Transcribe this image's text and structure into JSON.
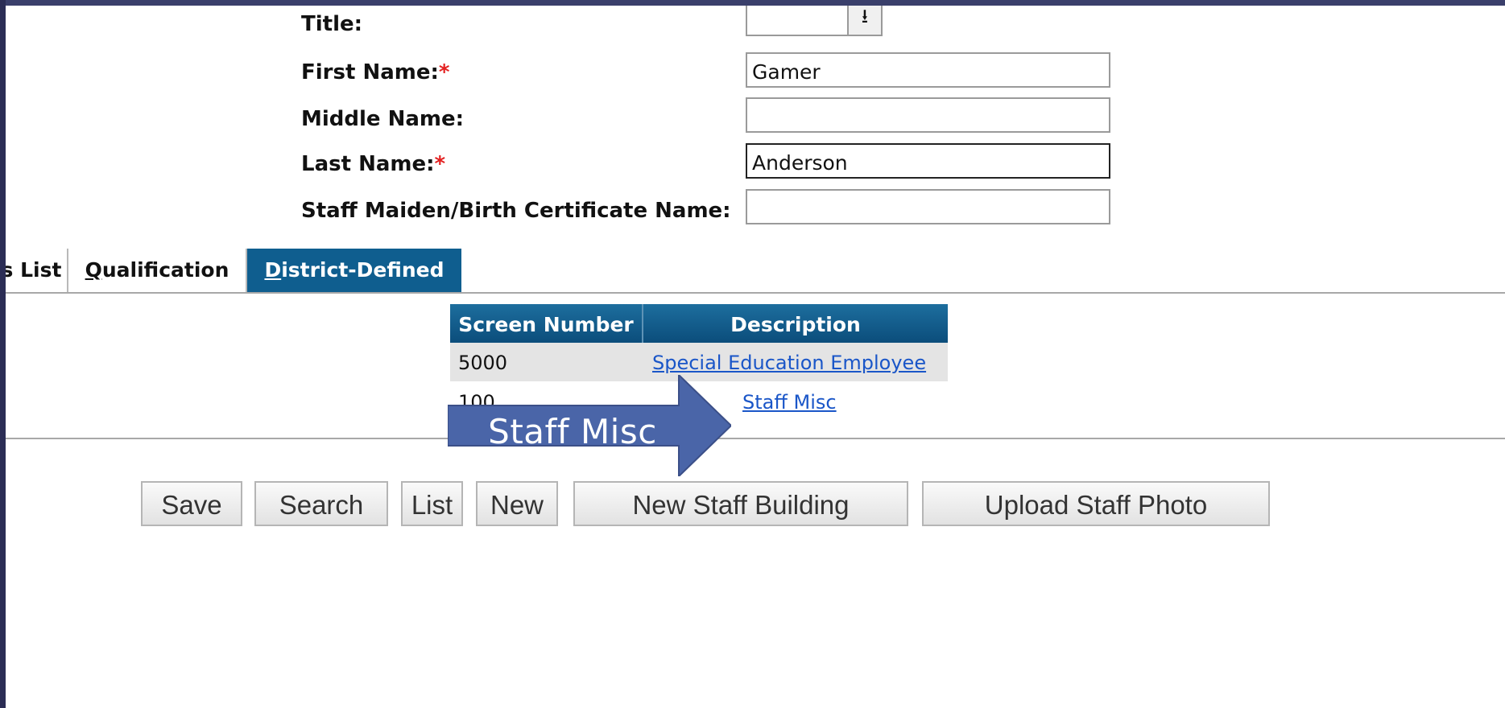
{
  "form": {
    "title_label": "Title:",
    "first_name_label": "First Name:",
    "first_name_value": "Gamer",
    "middle_name_label": "Middle Name:",
    "middle_name_value": "",
    "last_name_label": "Last Name:",
    "last_name_value": "Anderson",
    "maiden_name_label": "Staff Maiden/Birth Certificate Name:",
    "maiden_name_value": "",
    "required_marker": "*",
    "dropdown_arrow": "⭳"
  },
  "tabs": {
    "partial_list_label": "s List",
    "qualification_first": "Q",
    "qualification_rest": "ualification",
    "district_first": "D",
    "district_rest": "istrict-Defined"
  },
  "grid": {
    "headers": [
      "Screen Number",
      "Description"
    ],
    "rows": [
      {
        "screen_number": "5000",
        "description": "Special Education Employee"
      },
      {
        "screen_number": "100",
        "description": "Staff Misc"
      }
    ]
  },
  "buttons": {
    "save": "Save",
    "search": "Search",
    "list": "List",
    "new": "New",
    "new_staff_building": "New Staff Building",
    "upload_staff_photo": "Upload Staff Photo"
  },
  "callout": {
    "text": "Staff Misc",
    "fill_color": "#4a65a8"
  },
  "colors": {
    "tab_active": "#0f5e8f",
    "grid_header": "#0b4d7b",
    "link": "#1a56c8",
    "required": "#e32121",
    "frame": "#2b2d55"
  }
}
